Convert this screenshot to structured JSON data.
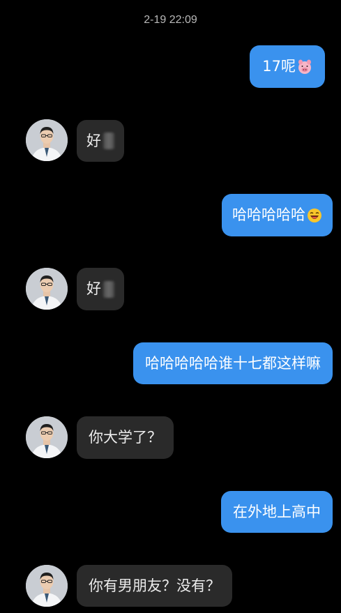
{
  "chat": {
    "timestamp": "2-19 22:09",
    "messages": [
      {
        "side": "out",
        "text": "17呢",
        "emoji": "pig-face"
      },
      {
        "side": "in",
        "text": "好",
        "redacted": true
      },
      {
        "side": "out",
        "text": "哈哈哈哈哈",
        "emoji": "laughing-face"
      },
      {
        "side": "in",
        "text": "好",
        "redacted": true
      },
      {
        "side": "out",
        "text": "哈哈哈哈哈谁十七都这样嘛"
      },
      {
        "side": "in",
        "text": "你大学了？"
      },
      {
        "side": "out",
        "text": "在外地上高中"
      },
      {
        "side": "in",
        "text": "你有男朋友？没有？"
      }
    ]
  },
  "colors": {
    "background": "#000000",
    "outgoing_bubble": "#3a92ee",
    "incoming_bubble": "#2a2a2a",
    "timestamp_text": "#b9b9b9"
  }
}
